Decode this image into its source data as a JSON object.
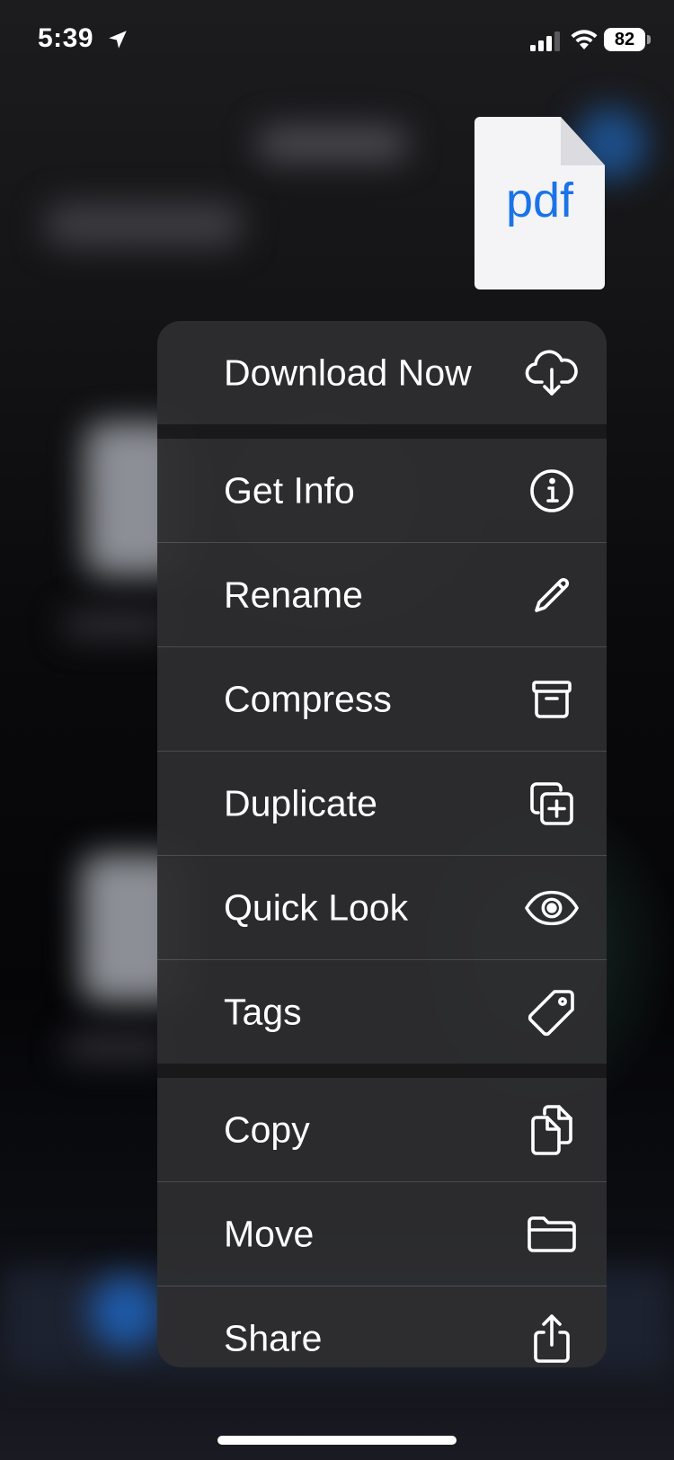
{
  "status_bar": {
    "time": "5:39",
    "battery_percent": "82",
    "cellular_signal_bars": 3,
    "location_icon": "location-arrow-icon",
    "wifi_icon": "wifi-icon"
  },
  "file_preview": {
    "type_label": "pdf",
    "label_color": "#1a73e8"
  },
  "context_menu": {
    "items": [
      {
        "label": "Download Now",
        "icon": "cloud-download-icon"
      },
      {
        "label": "Get Info",
        "icon": "info-circle-icon"
      },
      {
        "label": "Rename",
        "icon": "pencil-icon"
      },
      {
        "label": "Compress",
        "icon": "archive-box-icon"
      },
      {
        "label": "Duplicate",
        "icon": "duplicate-plus-icon"
      },
      {
        "label": "Quick Look",
        "icon": "eye-icon"
      },
      {
        "label": "Tags",
        "icon": "tag-icon"
      },
      {
        "label": "Copy",
        "icon": "copy-documents-icon"
      },
      {
        "label": "Move",
        "icon": "folder-icon"
      },
      {
        "label": "Share",
        "icon": "share-icon"
      }
    ]
  }
}
